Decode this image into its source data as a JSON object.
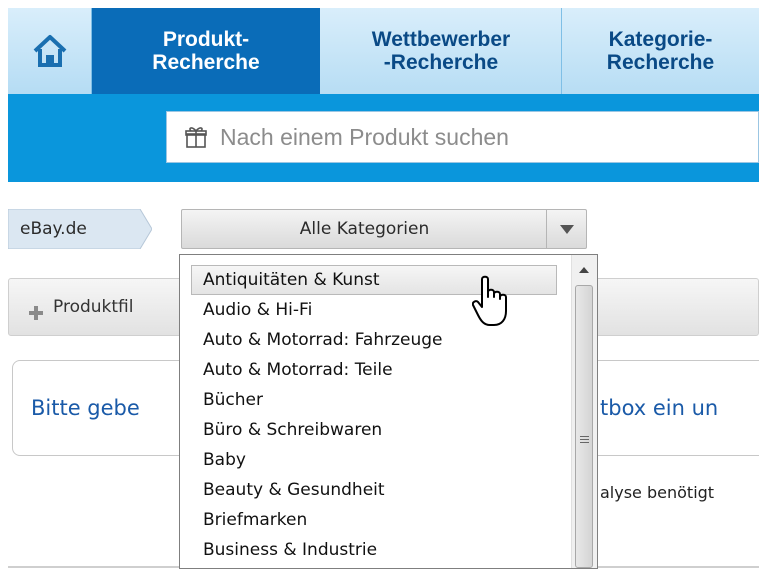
{
  "nav": {
    "home_icon": "home-icon",
    "tabs": [
      {
        "line1": "Produkt-",
        "line2": "Recherche",
        "active": true
      },
      {
        "line1": "Wettbewerber",
        "line2": "-Recherche",
        "active": false
      },
      {
        "line1": "Kategorie-",
        "line2": "Recherche",
        "active": false
      }
    ]
  },
  "search": {
    "placeholder": "Nach einem Produkt suchen",
    "icon": "gift-box-icon"
  },
  "breadcrumb": {
    "marketplace": "eBay.de"
  },
  "category_select": {
    "value": "Alle Kategorien",
    "options": [
      "Antiquitäten & Kunst",
      "Audio & Hi-Fi",
      "Auto & Motorrad: Fahrzeuge",
      "Auto & Motorrad: Teile",
      "Bücher",
      "Büro & Schreibwaren",
      "Baby",
      "Beauty & Gesundheit",
      "Briefmarken",
      "Business & Industrie"
    ],
    "hovered_index": 0
  },
  "filter": {
    "label": "Produktfil"
  },
  "message": {
    "text_left": "Bitte gebe",
    "text_right": "tbox ein un",
    "note_right": "alyse benötigt"
  },
  "colors": {
    "nav_blue": "#0a96dc",
    "active_tab": "#0a6cb8",
    "link_blue": "#1a5aa8"
  }
}
